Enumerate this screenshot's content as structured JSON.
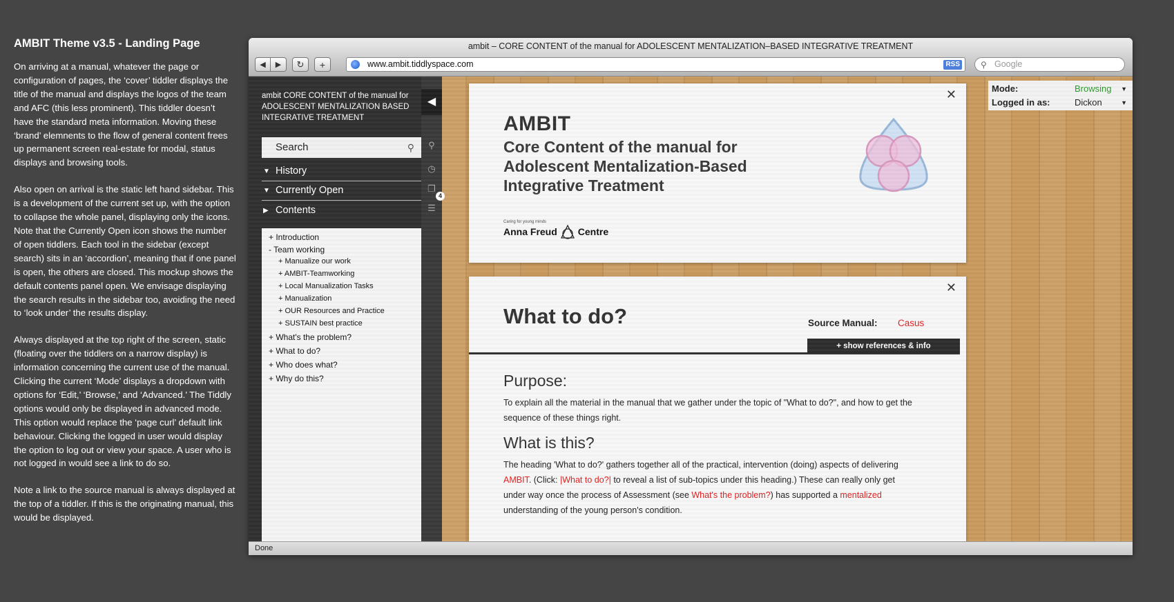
{
  "notes": {
    "title": "AMBIT Theme v3.5 - Landing Page",
    "paragraphs": [
      "On arriving at a manual, whatever the page or configuration of pages, the ‘cover’ tiddler displays the title of the manual and displays the logos of the team and AFC (this less prominent). This tiddler doesn’t have the standard meta information. Moving these ‘brand’ elemnents to the flow of general content frees up permanent screen real-estate for modal, status displays and browsing tools.",
      "Also open on arrival is the static left hand sidebar. This is a development of the current set up, with the option to collapse the whole panel, displaying only the icons. Note that the Currently Open icon shows the number of open tiddlers. Each tool in the sidebar (except search) sits in an ‘accordion’, meaning that if one panel is open, the others are closed. This mockup shows the default contents panel open. We envisage displaying the search results in the sidebar too, avoiding the need to ‘look under’ the results display.",
      "Always displayed at the top right of the screen, static (floating over the tiddlers on a narrow display) is information concerning the current use of the manual. Clicking the current ‘Mode’ displays a dropdown with options for ‘Edit,’ ‘Browse,’ and ‘Advanced.’ The Tiddly options would only be displayed in advanced mode. This option would replace the ‘page curl’ default link behaviour. Clicking the logged in user would display the option to log out or view your space. A user who is not logged in would see a link to do so.",
      "Note a link to the source manual is always displayed at the top of a tiddler. If this is the originating manual, this would be displayed."
    ]
  },
  "browser": {
    "title": "ambit – CORE CONTENT of the manual for ADOLESCENT MENTALIZATION–BASED INTEGRATIVE TREATMENT",
    "url": "www.ambit.tiddlyspace.com",
    "rss": "RSS",
    "search_placeholder": "Google",
    "status": "Done",
    "buttons": {
      "back": "◀",
      "forward": "▶",
      "reload": "↻",
      "add": "+"
    }
  },
  "sidebar": {
    "title": "ambit CORE CONTENT of the manual for ADOLESCENT MENTALIZATION BASED INTEGRATIVE TREATMENT",
    "search_label": "Search",
    "sections": [
      "History",
      "Currently Open",
      "Contents"
    ],
    "open_count": "4",
    "tree": [
      "+ Introduction",
      "- Team working",
      "+ Manualize our work",
      "+ AMBIT-Teamworking",
      "+ Local Manualization Tasks",
      "+ Manualization",
      "+ OUR Resources and Practice",
      "+ SUSTAIN best practice",
      "+ What's the problem?",
      "+ What to do?",
      "+ Who does what?",
      "+ Why do this?"
    ]
  },
  "cover": {
    "heading": "AMBIT",
    "subtitle": "Core Content of the manual for Adolescent Mentalization-Based Integrative Treatment",
    "afc_tagline": "Caring for young minds",
    "afc_name_1": "Anna Freud",
    "afc_name_2": "Centre"
  },
  "tiddler": {
    "title": "What to do?",
    "source_label": "Source Manual:",
    "source_value": "Casus",
    "show_refs": "+ show references & info",
    "purpose_heading": "Purpose:",
    "purpose_text": "To explain all the material in the manual that we gather under the topic of \"What to do?\", and how to get the sequence of these things right.",
    "what_heading": "What is this?",
    "what_t1": "The heading 'What to do?' gathers together all of the practical, intervention (doing) aspects of delivering ",
    "what_link1": "AMBIT",
    "what_t2": ". (Click: ",
    "what_link2": "|What to do?|",
    "what_t3": " to reveal a list of sub-topics under this heading.) These can really only get under way once the process of Assessment (see ",
    "what_link3": "What's the problem?",
    "what_t4": ") has supported a ",
    "what_link4": "mentalized",
    "what_t5": " understanding of the young person's condition."
  },
  "status": {
    "mode_label": "Mode:",
    "mode_value": "Browsing",
    "mode_color": "#2a9a2a",
    "user_label": "Logged in as:",
    "user_value": "Dickon"
  }
}
